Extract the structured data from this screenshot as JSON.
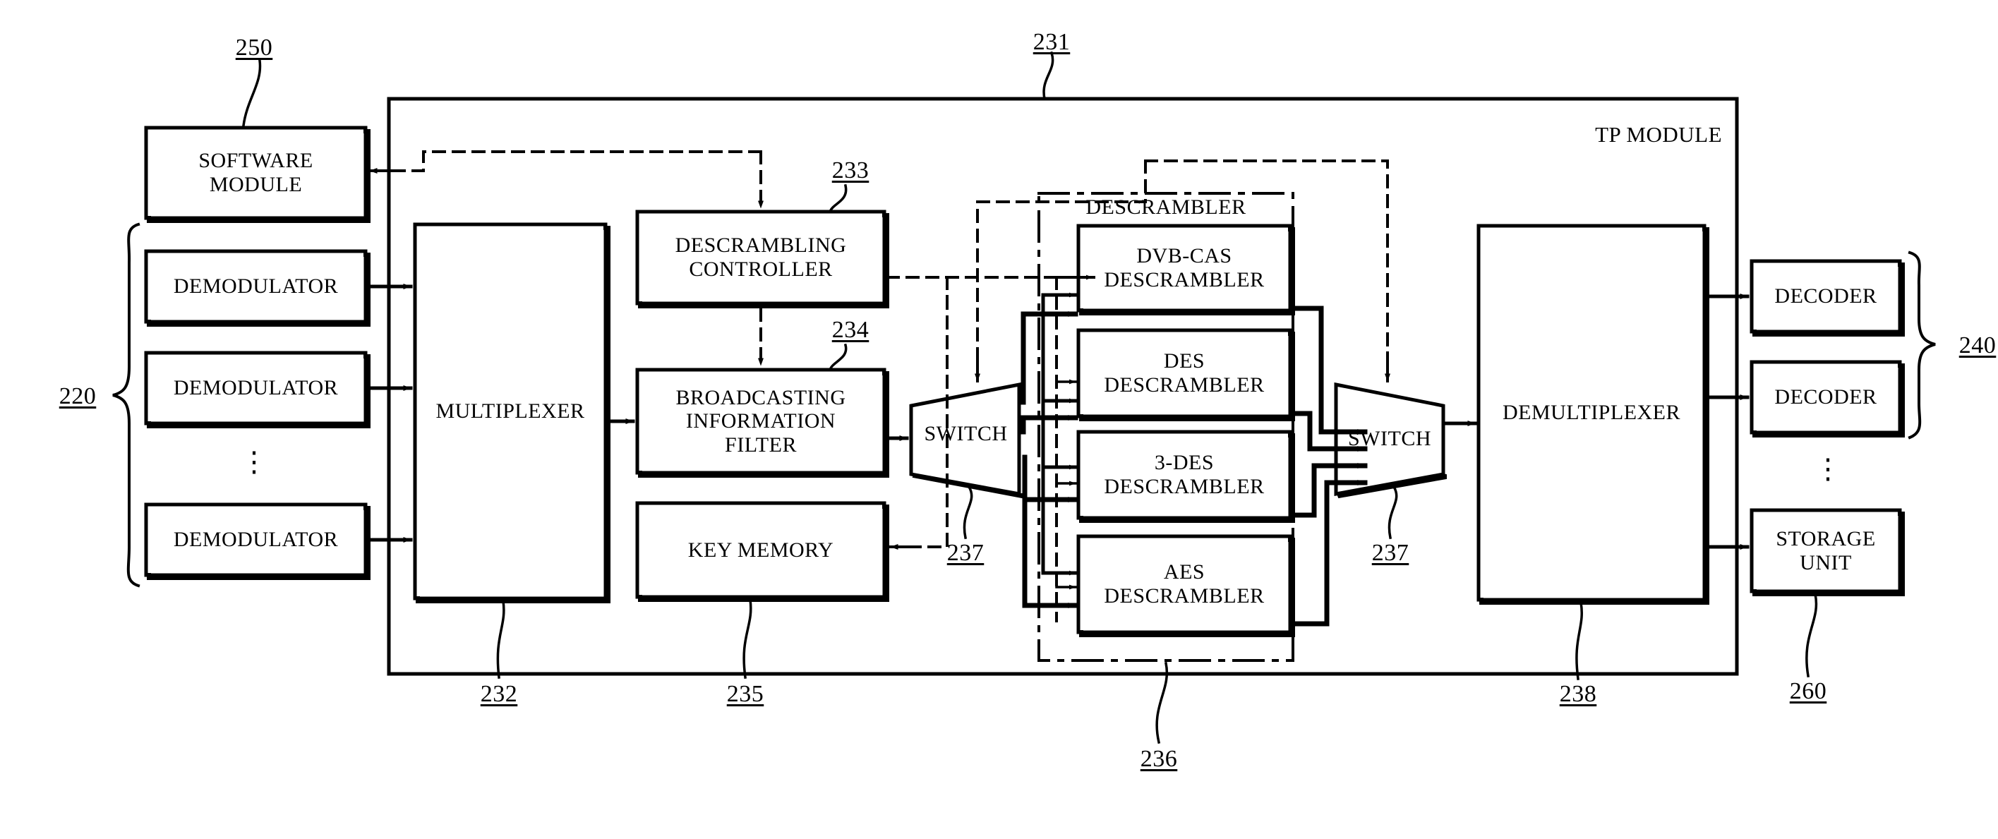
{
  "figure": {
    "title": "TP module block diagram",
    "module_label": "TP MODULE",
    "descrambler_group_label": "DESCRAMBLER"
  },
  "blocks": {
    "software_module": "SOFTWARE\nMODULE",
    "software_module_line1": "SOFTWARE",
    "software_module_line2": "MODULE",
    "demodulator": "DEMODULATOR",
    "multiplexer": "MULTIPLEXER",
    "descrambling_controller_line1": "DESCRAMBLING",
    "descrambling_controller_line2": "CONTROLLER",
    "broadcasting_filter_line1": "BROADCASTING",
    "broadcasting_filter_line2": "INFORMATION",
    "broadcasting_filter_line3": "FILTER",
    "key_memory": "KEY MEMORY",
    "switch": "SWITCH",
    "dvb_cas_line1": "DVB-CAS",
    "dvb_cas_line2": "DESCRAMBLER",
    "des_line1": "DES",
    "des_line2": "DESCRAMBLER",
    "triple_des_line1": "3-DES",
    "triple_des_line2": "DESCRAMBLER",
    "aes_line1": "AES",
    "aes_line2": "DESCRAMBLER",
    "demultiplexer": "DEMULTIPLEXER",
    "decoder": "DECODER",
    "storage_unit_line1": "STORAGE",
    "storage_unit_line2": "UNIT"
  },
  "reference_numerals": {
    "tp_module": "231",
    "software_module": "250",
    "demodulators_group": "220",
    "multiplexer": "232",
    "descrambling_controller": "233",
    "broadcasting_filter": "234",
    "key_memory": "235",
    "descrambler_group": "236",
    "switch_left": "237",
    "switch_right": "237",
    "demultiplexer": "238",
    "decoders_group": "240",
    "storage_unit": "260"
  },
  "colors": {
    "line": "#000000",
    "background": "#ffffff"
  },
  "ellipsis": "⋮"
}
